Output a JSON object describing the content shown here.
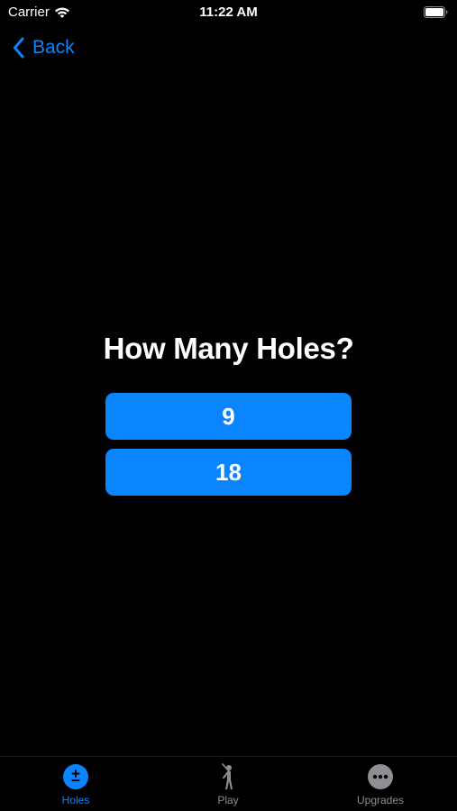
{
  "status_bar": {
    "carrier": "Carrier",
    "time": "11:22 AM",
    "wifi_icon": "wifi-icon",
    "battery_icon": "battery-icon"
  },
  "nav": {
    "back_label": "Back",
    "back_icon": "chevron-left-icon"
  },
  "main": {
    "title": "How Many Holes?",
    "options": [
      "9",
      "18"
    ]
  },
  "tab_bar": {
    "tabs": [
      {
        "label": "Holes",
        "icon": "plus-minus-circle-icon",
        "selected": true
      },
      {
        "label": "Play",
        "icon": "golfer-icon",
        "selected": false
      },
      {
        "label": "Upgrades",
        "icon": "ellipsis-circle-icon",
        "selected": false
      }
    ]
  },
  "colors": {
    "accent": "#0a84ff",
    "background": "#000000",
    "inactive": "#8e8e93",
    "text": "#ffffff"
  }
}
